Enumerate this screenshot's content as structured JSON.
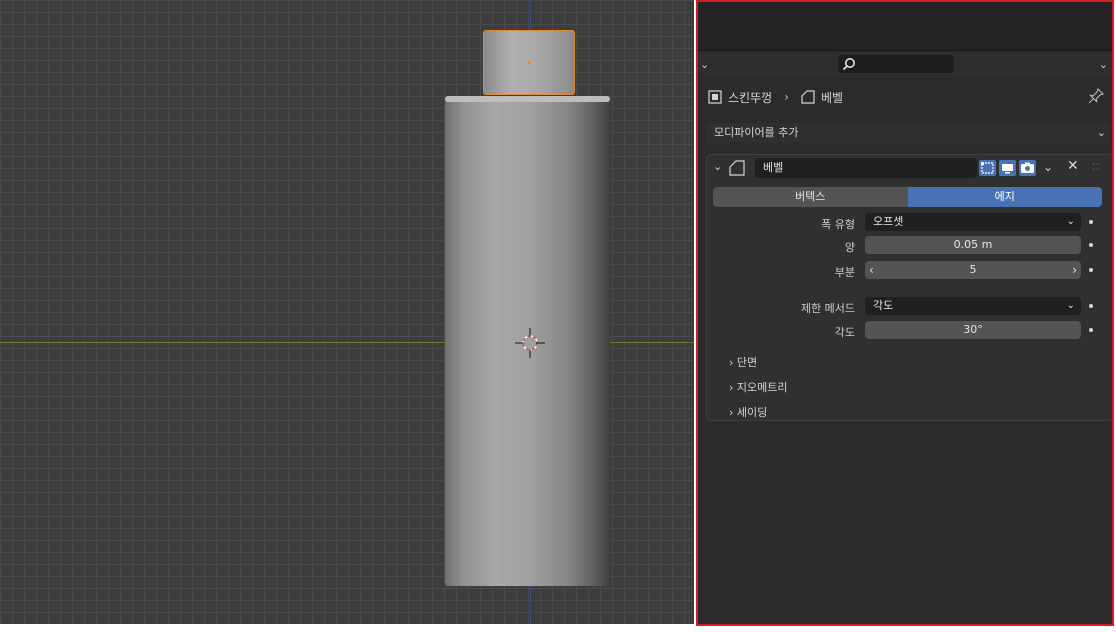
{
  "viewport": {
    "objects": [
      "bottle-body",
      "bottle-cap"
    ]
  },
  "panel": {
    "breadcrumb": {
      "object_name": "스킨뚜껑",
      "modifier_name": "베벨"
    },
    "add_modifier_label": "모디파이어를 추가",
    "modifier": {
      "name": "베벨",
      "mode_tabs": [
        {
          "label": "버텍스",
          "active": false
        },
        {
          "label": "에지",
          "active": true
        }
      ],
      "properties": [
        {
          "label": "폭 유형",
          "value": "오프셋"
        },
        {
          "label": "양",
          "value": "0.05 m"
        },
        {
          "label": "부분",
          "value": "5"
        },
        {
          "label": "제한 메서드",
          "value": "각도"
        },
        {
          "label": "각도",
          "value": "30°"
        }
      ],
      "subpanels": [
        "단면",
        "지오메트리",
        "세이딩"
      ]
    },
    "colors": {
      "accent": "#4772b3",
      "highlight_border": "#d01e24",
      "selection": "#e08a2c"
    },
    "icons": [
      "search-icon",
      "pin-icon",
      "object-icon",
      "modifier-icon",
      "close-icon",
      "chevron-down-icon"
    ]
  }
}
